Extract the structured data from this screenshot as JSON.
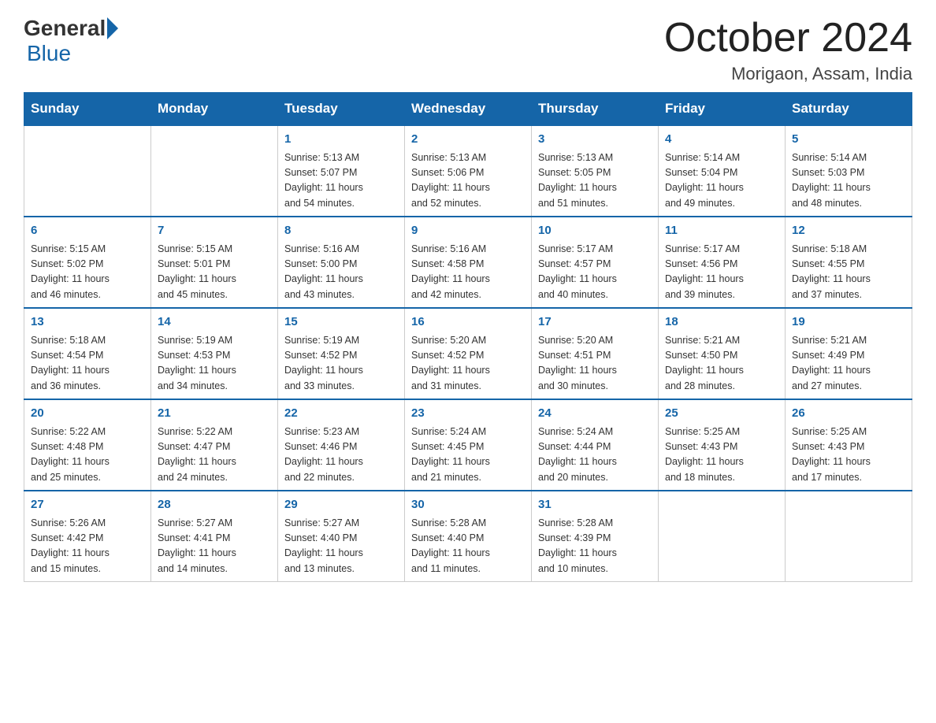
{
  "header": {
    "logo_general": "General",
    "logo_blue": "Blue",
    "month_title": "October 2024",
    "location": "Morigaon, Assam, India"
  },
  "days_of_week": [
    "Sunday",
    "Monday",
    "Tuesday",
    "Wednesday",
    "Thursday",
    "Friday",
    "Saturday"
  ],
  "weeks": [
    [
      {
        "day": "",
        "info": ""
      },
      {
        "day": "",
        "info": ""
      },
      {
        "day": "1",
        "info": "Sunrise: 5:13 AM\nSunset: 5:07 PM\nDaylight: 11 hours\nand 54 minutes."
      },
      {
        "day": "2",
        "info": "Sunrise: 5:13 AM\nSunset: 5:06 PM\nDaylight: 11 hours\nand 52 minutes."
      },
      {
        "day": "3",
        "info": "Sunrise: 5:13 AM\nSunset: 5:05 PM\nDaylight: 11 hours\nand 51 minutes."
      },
      {
        "day": "4",
        "info": "Sunrise: 5:14 AM\nSunset: 5:04 PM\nDaylight: 11 hours\nand 49 minutes."
      },
      {
        "day": "5",
        "info": "Sunrise: 5:14 AM\nSunset: 5:03 PM\nDaylight: 11 hours\nand 48 minutes."
      }
    ],
    [
      {
        "day": "6",
        "info": "Sunrise: 5:15 AM\nSunset: 5:02 PM\nDaylight: 11 hours\nand 46 minutes."
      },
      {
        "day": "7",
        "info": "Sunrise: 5:15 AM\nSunset: 5:01 PM\nDaylight: 11 hours\nand 45 minutes."
      },
      {
        "day": "8",
        "info": "Sunrise: 5:16 AM\nSunset: 5:00 PM\nDaylight: 11 hours\nand 43 minutes."
      },
      {
        "day": "9",
        "info": "Sunrise: 5:16 AM\nSunset: 4:58 PM\nDaylight: 11 hours\nand 42 minutes."
      },
      {
        "day": "10",
        "info": "Sunrise: 5:17 AM\nSunset: 4:57 PM\nDaylight: 11 hours\nand 40 minutes."
      },
      {
        "day": "11",
        "info": "Sunrise: 5:17 AM\nSunset: 4:56 PM\nDaylight: 11 hours\nand 39 minutes."
      },
      {
        "day": "12",
        "info": "Sunrise: 5:18 AM\nSunset: 4:55 PM\nDaylight: 11 hours\nand 37 minutes."
      }
    ],
    [
      {
        "day": "13",
        "info": "Sunrise: 5:18 AM\nSunset: 4:54 PM\nDaylight: 11 hours\nand 36 minutes."
      },
      {
        "day": "14",
        "info": "Sunrise: 5:19 AM\nSunset: 4:53 PM\nDaylight: 11 hours\nand 34 minutes."
      },
      {
        "day": "15",
        "info": "Sunrise: 5:19 AM\nSunset: 4:52 PM\nDaylight: 11 hours\nand 33 minutes."
      },
      {
        "day": "16",
        "info": "Sunrise: 5:20 AM\nSunset: 4:52 PM\nDaylight: 11 hours\nand 31 minutes."
      },
      {
        "day": "17",
        "info": "Sunrise: 5:20 AM\nSunset: 4:51 PM\nDaylight: 11 hours\nand 30 minutes."
      },
      {
        "day": "18",
        "info": "Sunrise: 5:21 AM\nSunset: 4:50 PM\nDaylight: 11 hours\nand 28 minutes."
      },
      {
        "day": "19",
        "info": "Sunrise: 5:21 AM\nSunset: 4:49 PM\nDaylight: 11 hours\nand 27 minutes."
      }
    ],
    [
      {
        "day": "20",
        "info": "Sunrise: 5:22 AM\nSunset: 4:48 PM\nDaylight: 11 hours\nand 25 minutes."
      },
      {
        "day": "21",
        "info": "Sunrise: 5:22 AM\nSunset: 4:47 PM\nDaylight: 11 hours\nand 24 minutes."
      },
      {
        "day": "22",
        "info": "Sunrise: 5:23 AM\nSunset: 4:46 PM\nDaylight: 11 hours\nand 22 minutes."
      },
      {
        "day": "23",
        "info": "Sunrise: 5:24 AM\nSunset: 4:45 PM\nDaylight: 11 hours\nand 21 minutes."
      },
      {
        "day": "24",
        "info": "Sunrise: 5:24 AM\nSunset: 4:44 PM\nDaylight: 11 hours\nand 20 minutes."
      },
      {
        "day": "25",
        "info": "Sunrise: 5:25 AM\nSunset: 4:43 PM\nDaylight: 11 hours\nand 18 minutes."
      },
      {
        "day": "26",
        "info": "Sunrise: 5:25 AM\nSunset: 4:43 PM\nDaylight: 11 hours\nand 17 minutes."
      }
    ],
    [
      {
        "day": "27",
        "info": "Sunrise: 5:26 AM\nSunset: 4:42 PM\nDaylight: 11 hours\nand 15 minutes."
      },
      {
        "day": "28",
        "info": "Sunrise: 5:27 AM\nSunset: 4:41 PM\nDaylight: 11 hours\nand 14 minutes."
      },
      {
        "day": "29",
        "info": "Sunrise: 5:27 AM\nSunset: 4:40 PM\nDaylight: 11 hours\nand 13 minutes."
      },
      {
        "day": "30",
        "info": "Sunrise: 5:28 AM\nSunset: 4:40 PM\nDaylight: 11 hours\nand 11 minutes."
      },
      {
        "day": "31",
        "info": "Sunrise: 5:28 AM\nSunset: 4:39 PM\nDaylight: 11 hours\nand 10 minutes."
      },
      {
        "day": "",
        "info": ""
      },
      {
        "day": "",
        "info": ""
      }
    ]
  ]
}
